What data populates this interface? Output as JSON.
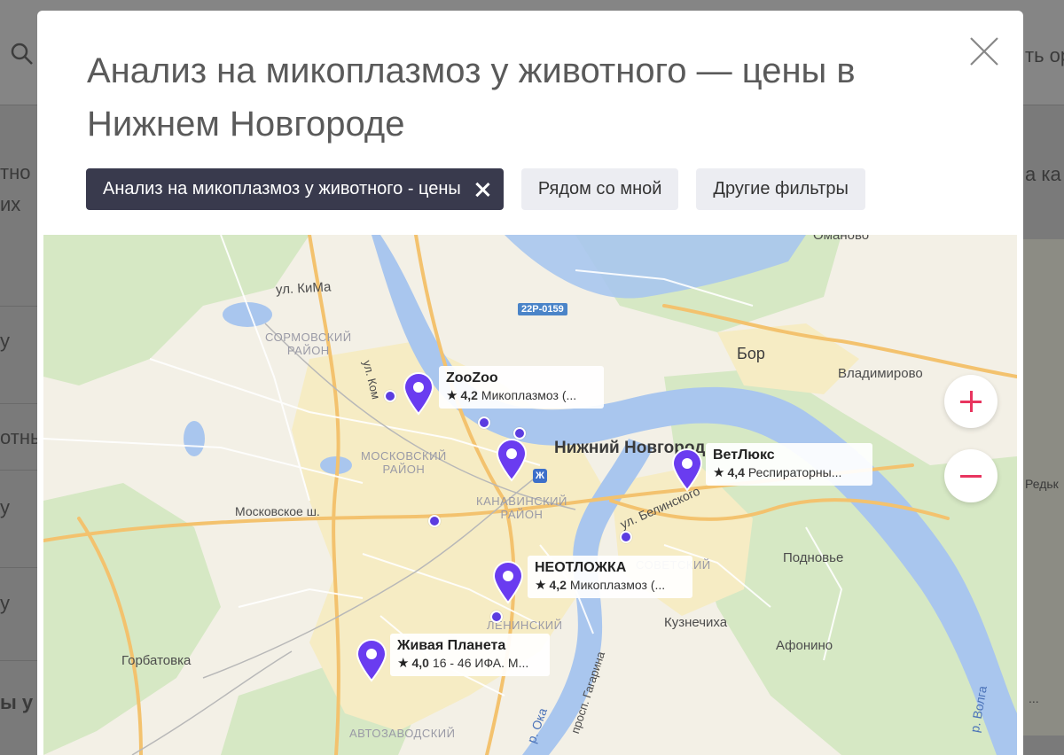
{
  "modal": {
    "title": "Анализ на микоплазмоз у животного — цены в Нижнем Новгороде"
  },
  "filters": {
    "active_chip": "Анализ на микоплазмоз у животного - цены",
    "nearby": "Рядом со мной",
    "other": "Другие фильтры"
  },
  "map": {
    "labels": {
      "omanovo": "Оманово",
      "kima": "ул. КиМа",
      "road": "22Р-0159",
      "sormovsky": "СОРМОВСКИЙ\nРАЙОН",
      "bor": "Бор",
      "vladimirovo": "Владимирово",
      "nizhny": "Нижний Новгород",
      "moskovsky": "МОСКОВСКИЙ\nРАЙОН",
      "kanavinsky": "КАНАВИНСКИЙ\nРАЙОН",
      "moskovskoe": "Московское ш.",
      "belinskogo": "ул. Белинского",
      "sovetsky": "СОВЕТСКИЙ",
      "podnovye": "Подновье",
      "leninsky": "ЛЕНИНСКИЙ",
      "kuznechikha": "Кузнечиха",
      "afonino": "Афонино",
      "gorbatovka": "Горбатовка",
      "gagarina": "просп. Гагарина",
      "oka": "р. Ока",
      "volga": "р. Волга",
      "avtozavodsky": "АВТОЗАВОДСКИЙ",
      "kom": "ул. Ком"
    },
    "places": [
      {
        "name": "ZooZoo",
        "rating": "4,2",
        "desc": "Микоплазмоз (..."
      },
      {
        "name": "ВетЛюкс",
        "rating": "4,4",
        "desc": "Респираторны..."
      },
      {
        "name": "НЕОТЛОЖКА",
        "rating": "4,2",
        "desc": "Микоплазмоз (..."
      },
      {
        "name": "Живая Планета",
        "rating": "4,0",
        "desc": "16 - 46 ИФА. М..."
      }
    ],
    "pin_color": "#6a3cf0",
    "accent_color": "#e8355f"
  },
  "background": {
    "fragments": {
      "left1": "тно",
      "left2": "их",
      "left3": "у",
      "left4": "отны",
      "left5": "у",
      "left6": "у",
      "left7": "ы у",
      "right1": "ть ор",
      "right2": "а ка",
      "right3": "Редьк",
      "right4": "..."
    }
  }
}
